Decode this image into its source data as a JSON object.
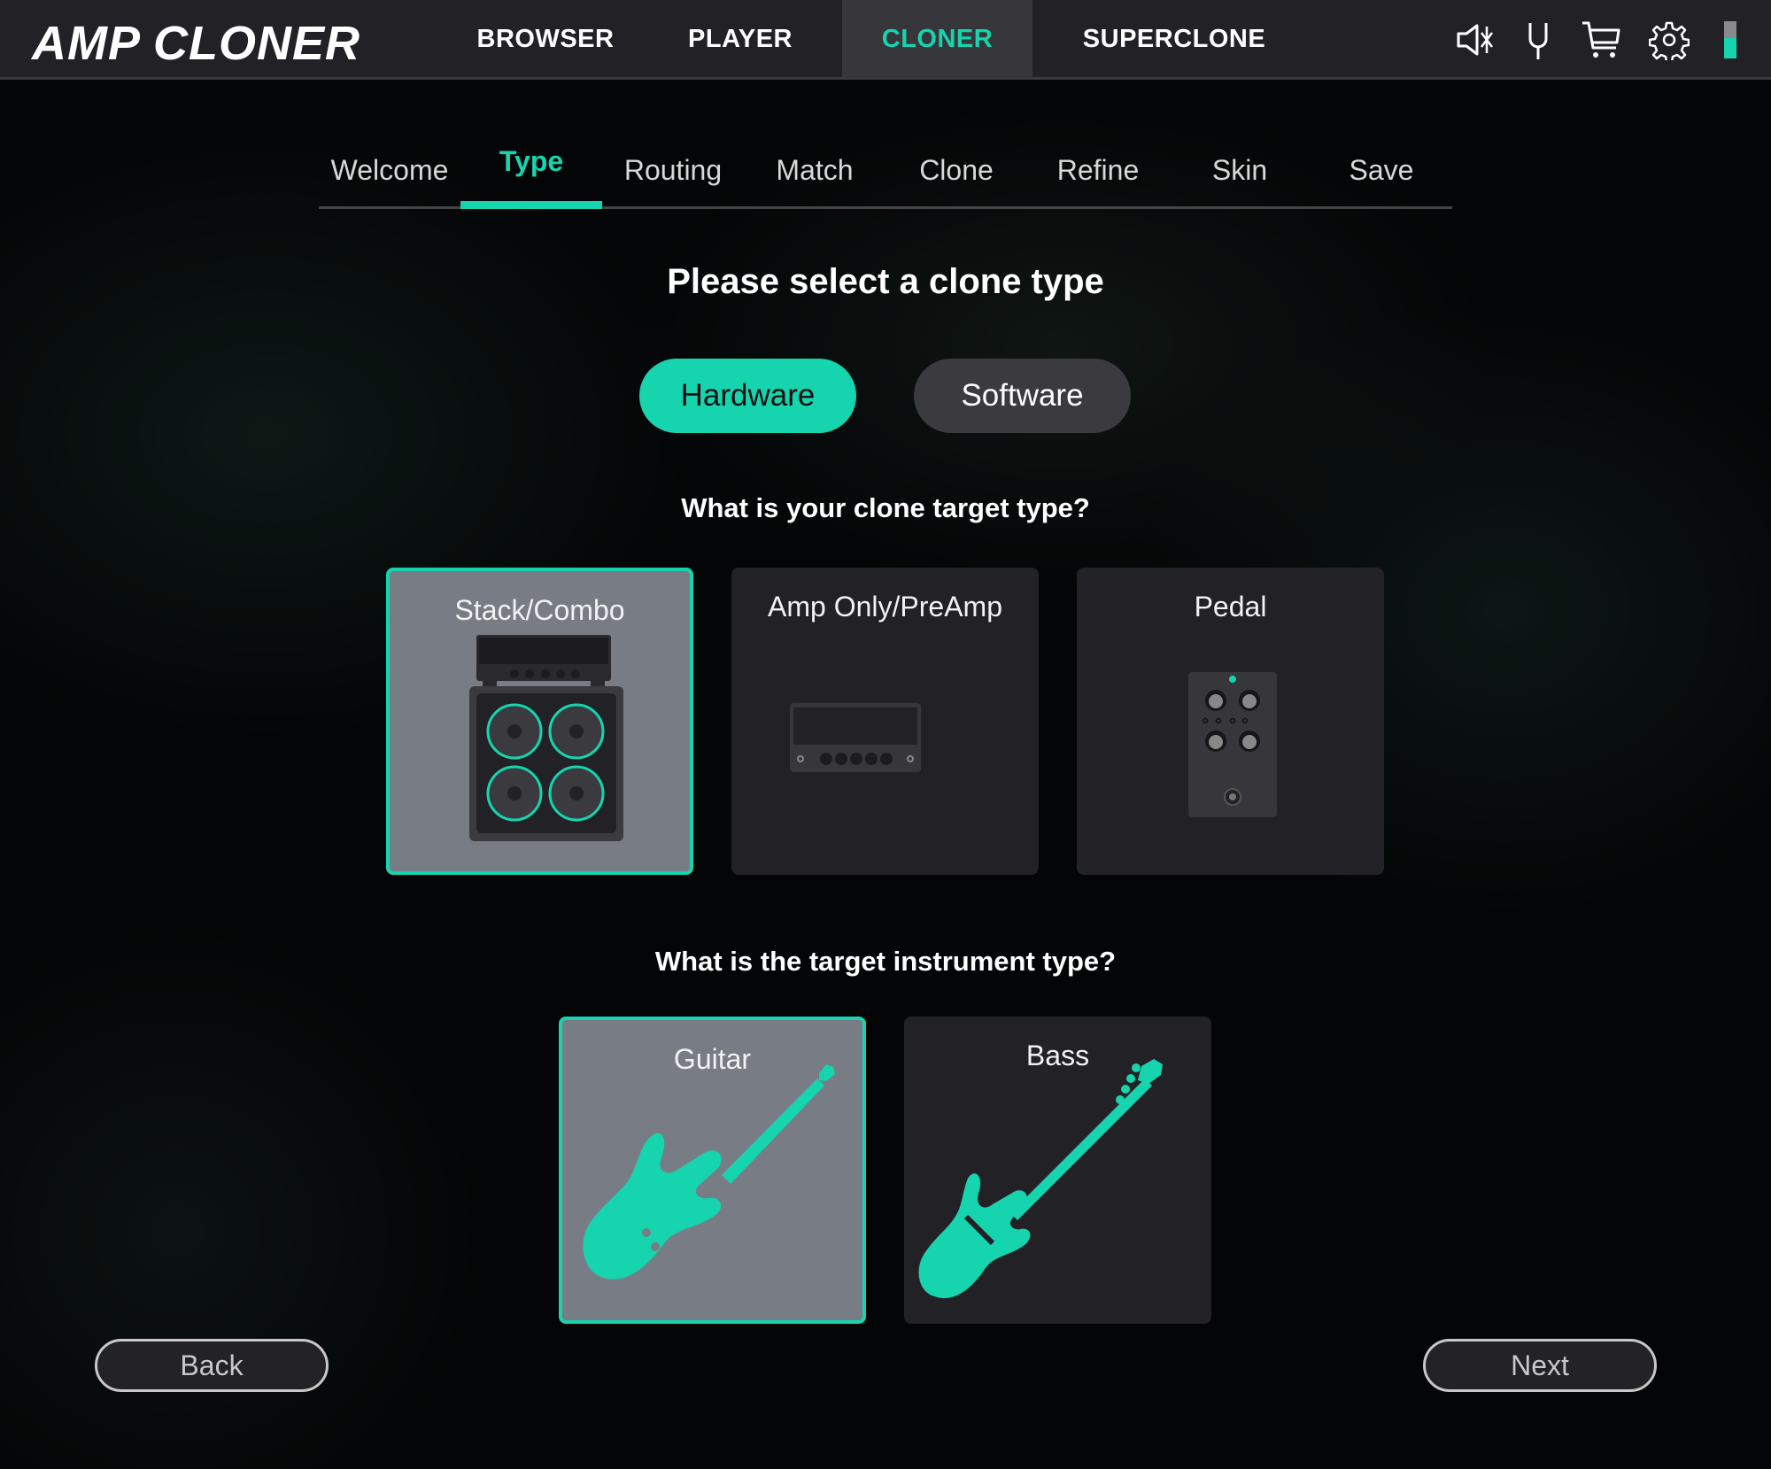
{
  "app": {
    "logo": "AMP CLONER"
  },
  "header": {
    "nav": [
      {
        "label": "BROWSER",
        "active": false
      },
      {
        "label": "PLAYER",
        "active": false
      },
      {
        "label": "CLONER",
        "active": true
      },
      {
        "label": "SUPERCLONE",
        "active": false
      }
    ],
    "icons": [
      "speaker-bluetooth-icon",
      "tuning-fork-icon",
      "cart-icon",
      "gear-icon"
    ],
    "level_meter": {
      "fraction": 0.55,
      "color": "#16d4ae"
    }
  },
  "steps": {
    "items": [
      "Welcome",
      "Type",
      "Routing",
      "Match",
      "Clone",
      "Refine",
      "Skin",
      "Save"
    ],
    "active_index": 1
  },
  "main": {
    "heading": "Please select a clone type",
    "clone_source": {
      "options": [
        "Hardware",
        "Software"
      ],
      "selected": "Hardware"
    },
    "target_question": "What is your clone target type?",
    "targets": [
      {
        "label": "Stack/Combo",
        "selected": true,
        "icon": "stack-amp-icon"
      },
      {
        "label": "Amp Only/PreAmp",
        "selected": false,
        "icon": "amp-head-icon"
      },
      {
        "label": "Pedal",
        "selected": false,
        "icon": "pedal-icon"
      }
    ],
    "instrument_question": "What is the target instrument type?",
    "instruments": [
      {
        "label": "Guitar",
        "selected": true,
        "icon": "electric-guitar-icon"
      },
      {
        "label": "Bass",
        "selected": false,
        "icon": "bass-guitar-icon"
      }
    ]
  },
  "footer": {
    "back_label": "Back",
    "next_label": "Next"
  },
  "colors": {
    "accent": "#16d4ae",
    "header_bg": "#222226",
    "card_bg": "#222226",
    "card_selected_bg": "#787c85"
  }
}
